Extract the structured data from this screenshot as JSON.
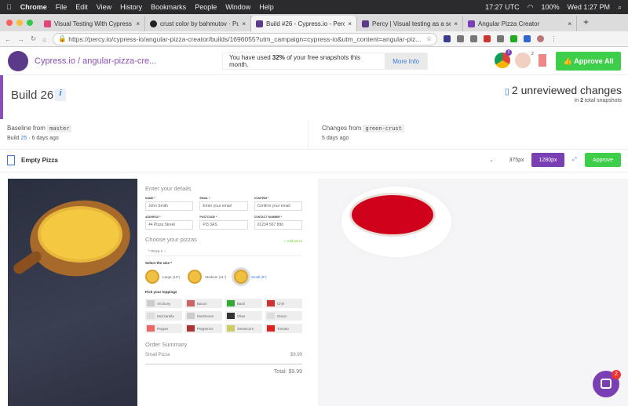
{
  "menubar": {
    "app": "Chrome",
    "items": [
      "File",
      "Edit",
      "View",
      "History",
      "Bookmarks",
      "People",
      "Window",
      "Help"
    ],
    "clock_utc": "17:27 UTC",
    "battery": "100%",
    "datetime": "Wed 1:27 PM"
  },
  "tabs": [
    {
      "title": "Visual Testing With Cypress a",
      "color": "#e0457b"
    },
    {
      "title": "crust color by bahmutov · Pull",
      "color": "#222"
    },
    {
      "title": "Build #26 - Cypress.io - Percy",
      "color": "#5b3a8a",
      "active": true
    },
    {
      "title": "Percy | Visual testing as a serv",
      "color": "#5b3a8a"
    },
    {
      "title": "Angular Pizza Creator",
      "color": "#7b3fb4"
    }
  ],
  "url": "https://percy.io/cypress-io/angular-pizza-creator/builds/1696055?utm_campaign=cypress-io&utm_content=angular-piz...",
  "header": {
    "breadcrumb": "Cypress.io / angular-pizza-cre...",
    "notice_pre": "You have used ",
    "notice_pct": "32%",
    "notice_post": " of your free snapshots this month.",
    "more_info": "More Info",
    "chrome_count": "2",
    "firefox_count": "2",
    "approve_all": "Approve All"
  },
  "build": {
    "title": "Build 26",
    "info": "i",
    "changes": "2 unreviewed changes",
    "changes_sub_pre": "in ",
    "changes_sub_count": "2",
    "changes_sub_post": " total snapshots",
    "baseline_label": "Baseline from",
    "baseline_branch": "master",
    "baseline_meta_pre": "Build ",
    "baseline_build": "25",
    "baseline_meta_post": " · 6 days ago",
    "changes_label": "Changes from",
    "changes_branch": "green-crust",
    "changes_meta": "5 days ago"
  },
  "snapshot": {
    "name": "Empty Pizza",
    "widths": [
      "375px",
      "1280px"
    ],
    "approve": "Approve"
  },
  "form": {
    "details_title": "Enter your details",
    "fields": [
      {
        "label": "NAME *",
        "value": "John Smith"
      },
      {
        "label": "EMAIL *",
        "value": "Enter your email"
      },
      {
        "label": "CONFIRM *",
        "value": "Confirm your email"
      },
      {
        "label": "ADDRESS *",
        "value": "44 Pizza Street"
      },
      {
        "label": "POSTCODE *",
        "value": "PI3 3AS"
      },
      {
        "label": "CONTACT NUMBER *",
        "value": "01234 567 890"
      }
    ],
    "pizzas_title": "Choose your pizzas",
    "add_pizza": "+ Add pizza",
    "pizza_item": "Pizza 1",
    "size_label": "Select the size *",
    "sizes": [
      "Large (13\")",
      "Medium (11\")",
      "Small (9\")"
    ],
    "toppings_label": "Pick your toppings",
    "toppings": [
      "Anchovy",
      "Bacon",
      "Basil",
      "Chili",
      "Mozzarella",
      "Mushroom",
      "Olive",
      "Onion",
      "Pepper",
      "Pepperoni",
      "Sweetcorn",
      "Tomato"
    ],
    "summary_title": "Order Summary",
    "summary_item": "Small Pizza",
    "summary_price": "$9.99",
    "total": "Total: $9.99"
  },
  "chat_badge": "2",
  "colors": {
    "brand": "#8a4fb4",
    "approve": "#3ecf4a",
    "crust_baseline": "#f5c842",
    "crust_change": "#d0021b"
  }
}
